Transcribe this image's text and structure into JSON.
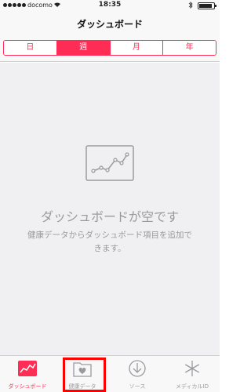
{
  "status": {
    "carrier": "docomo",
    "time": "18:35"
  },
  "nav": {
    "title": "ダッシュボード"
  },
  "segments": [
    {
      "label": "日",
      "active": false
    },
    {
      "label": "週",
      "active": true
    },
    {
      "label": "月",
      "active": false
    },
    {
      "label": "年",
      "active": false
    }
  ],
  "empty": {
    "title": "ダッシュボードが空です",
    "description": "健康データからダッシュボード項目を追加できます。"
  },
  "tabs": [
    {
      "label": "ダッシュボード",
      "icon": "dashboard-chart-icon",
      "active": true
    },
    {
      "label": "健康データ",
      "icon": "health-data-folder-icon",
      "active": false
    },
    {
      "label": "ソース",
      "icon": "download-icon",
      "active": false
    },
    {
      "label": "メディカルID",
      "icon": "asterisk-icon",
      "active": false
    }
  ],
  "colors": {
    "accent": "#ff2d55",
    "highlight": "#ff0000"
  }
}
